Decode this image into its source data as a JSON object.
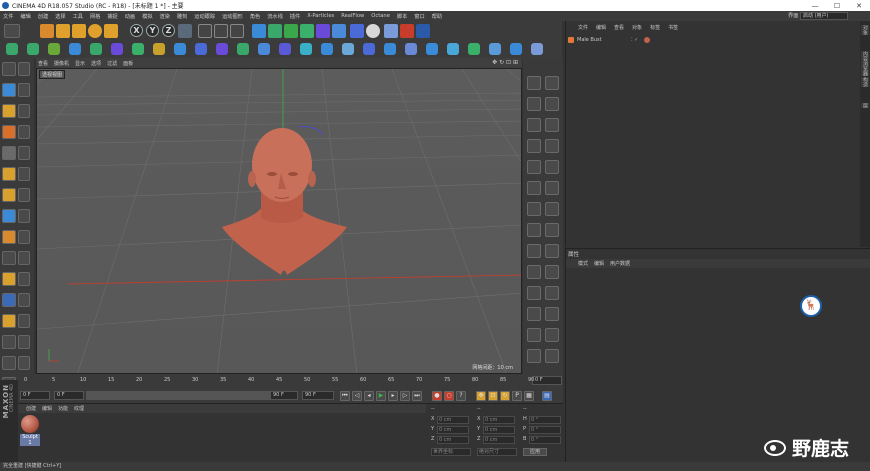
{
  "window": {
    "title": "CINEMA 4D R18.057 Studio (RC - R18) - [未标题 1 *] - 主要",
    "minimize": "—",
    "maximize": "☐",
    "close": "✕"
  },
  "menubar": {
    "items": [
      "文件",
      "编辑",
      "创建",
      "选择",
      "工具",
      "网格",
      "捕捉",
      "动画",
      "模拟",
      "渲染",
      "雕刻",
      "运动跟踪",
      "运动图形",
      "角色",
      "流水线",
      "插件",
      "X-Particles",
      "RealFlow",
      "Octane",
      "脚本",
      "窗口",
      "帮助"
    ],
    "layout_label": "界面",
    "layout_value": "启动 (用户)"
  },
  "toolbar": {
    "axis_x": "X",
    "axis_y": "Y",
    "axis_z": "Z"
  },
  "viewport": {
    "menu": [
      "查看",
      "摄像机",
      "显示",
      "选项",
      "过滤",
      "面板"
    ],
    "camera_label": "透视视图",
    "grid_scale": "网格间距：10 cm"
  },
  "timeline": {
    "ticks": [
      "0",
      "5",
      "10",
      "15",
      "20",
      "25",
      "30",
      "35",
      "40",
      "45",
      "50",
      "55",
      "60",
      "65",
      "70",
      "75",
      "80",
      "85",
      "90"
    ],
    "end_frame": "0 F"
  },
  "transport": {
    "current_frame": "0 F",
    "min_frame": "0 F",
    "max_frame": "90 F",
    "max_frame2": "90 F"
  },
  "materials": {
    "menu": [
      "创建",
      "编辑",
      "功能",
      "纹理"
    ],
    "items": [
      {
        "name": "Sculpt 1"
      }
    ]
  },
  "coordinates": {
    "header_left": "--",
    "header_mid": "--",
    "header_right": "--",
    "rows": [
      {
        "axis": "X",
        "pos": "0 cm",
        "size_axis": "X",
        "size": "0 cm",
        "rot_axis": "H",
        "rot": "0 °"
      },
      {
        "axis": "Y",
        "pos": "0 cm",
        "size_axis": "Y",
        "size": "0 cm",
        "rot_axis": "P",
        "rot": "0 °"
      },
      {
        "axis": "Z",
        "pos": "0 cm",
        "size_axis": "Z",
        "size": "0 cm",
        "rot_axis": "B",
        "rot": "0 °"
      }
    ],
    "mode_world": "世界坐标",
    "mode_scale": "绝对尺寸",
    "apply": "应用"
  },
  "objects": {
    "menu": [
      "文件",
      "编辑",
      "查看",
      "对象",
      "标签",
      "书签"
    ],
    "items": [
      {
        "name": "Male Bust"
      }
    ]
  },
  "sidetabs": [
    "对象",
    "内容浏览器",
    "构造",
    "层"
  ],
  "attributes": {
    "title": "属性",
    "menu": [
      "模式",
      "编辑",
      "用户数据"
    ]
  },
  "status": "完全重建 [快捷键 Ctrl+Y]",
  "watermark": "野鹿志",
  "colors": {
    "bust": "#c8705a",
    "x_axis": "#c83c2c",
    "y_axis": "#3cb04c"
  }
}
